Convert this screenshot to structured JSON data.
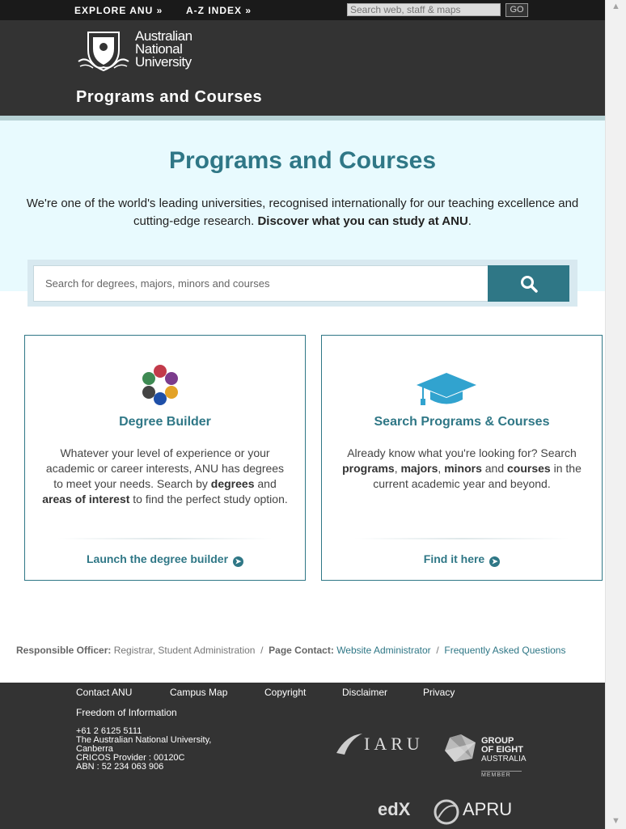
{
  "topbar": {
    "explore_label": "EXPLORE ANU »",
    "az_label": "A-Z INDEX »",
    "search_placeholder": "Search web, staff & maps",
    "go_label": "GO"
  },
  "header": {
    "logo_line1": "Australian",
    "logo_line2": "National",
    "logo_line3": "University",
    "site_title": "Programs and Courses"
  },
  "hero": {
    "title": "Programs and Courses",
    "intro": "We're one of the world's leading universities, recognised internationally for our teaching excellence and cutting-edge research.",
    "intro_bold": "Discover what you can study at ANU",
    "intro_end": "."
  },
  "search": {
    "placeholder": "Search for degrees, majors, minors and courses",
    "button_icon": "search-icon"
  },
  "cards": {
    "left": {
      "icon": "degree-builder-dots-icon",
      "title": "Degree Builder",
      "desc_1": "Whatever your level of experience or your academic or career interests, ANU has degrees to meet your needs. Search by",
      "desc_b1": "degrees",
      "desc_2": "and",
      "desc_b2": "areas of interest",
      "desc_3": "to find the perfect study option.",
      "cta": "Launch the degree builder"
    },
    "right": {
      "icon": "graduation-cap-icon",
      "title": "Search Programs & Courses",
      "desc_1": "Already know what you're looking for? Search",
      "desc_b1": "programs",
      "desc_sep1": ",",
      "desc_b2": "majors",
      "desc_sep2": ",",
      "desc_b3": "minors",
      "desc_2": "and",
      "desc_b4": "courses",
      "desc_3": "in the current academic year and beyond.",
      "cta": "Find it here"
    }
  },
  "responsible": {
    "officer_label": "Responsible Officer:",
    "officer_value": "Registrar, Student Administration",
    "sep1": "/",
    "contact_label": "Page Contact:",
    "contact_value": "Website Administrator",
    "sep2": "/",
    "faq": "Frequently Asked Questions"
  },
  "footer": {
    "links": [
      "Contact ANU",
      "Campus Map",
      "Copyright",
      "Disclaimer",
      "Privacy",
      "Freedom of Information"
    ],
    "phone": "+61 2 6125 5111",
    "address": "The Australian National University, Canberra",
    "cricos": "CRICOS Provider : 00120C",
    "abn": "ABN : 52 234 063 906",
    "iaru": "IARU",
    "go8_line1": "GROUP",
    "go8_line2": "OF EIGHT",
    "go8_line3": "AUSTRALIA",
    "go8_member": "MEMBER",
    "edx": "edX",
    "apru": "APRU"
  },
  "colors": {
    "brand_teal": "#2f7786",
    "header_dark": "#333333",
    "hero_bg": "#e8fafe"
  }
}
